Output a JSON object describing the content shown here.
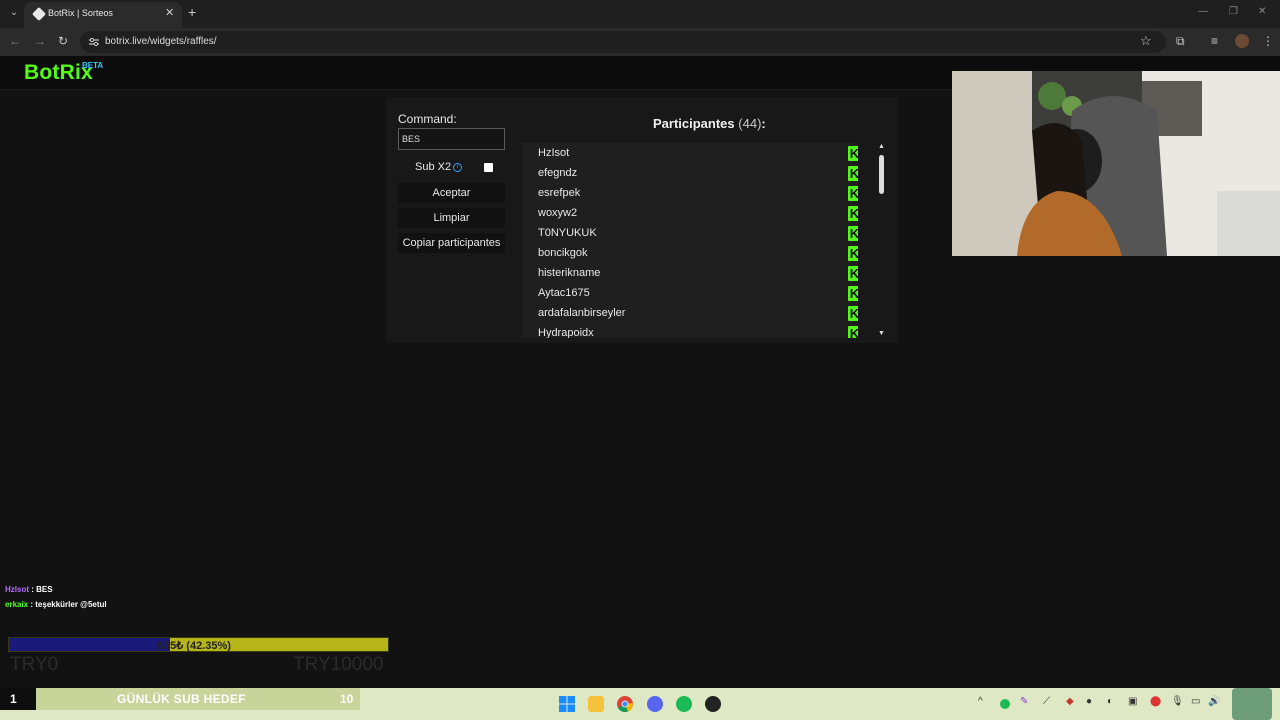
{
  "browser": {
    "tab_title": "BotRix | Sorteos",
    "url": "botrix.live/widgets/raffles/"
  },
  "app": {
    "logo": "BotRix",
    "logo_badge": "BETA"
  },
  "raffle": {
    "command_label": "Command:",
    "command_value": "BES",
    "sub_label": "Sub X2",
    "sub_checked": false,
    "accept_label": "Aceptar",
    "clear_label": "Limpiar",
    "copy_label": "Copiar participantes",
    "participants_title": "Participantes",
    "participants_count": "(44)",
    "participants_colon": ":",
    "participants": [
      {
        "name": "HzIsot",
        "badge": "K"
      },
      {
        "name": "efegndz",
        "badge": "K"
      },
      {
        "name": "esrefpek",
        "badge": "K"
      },
      {
        "name": "woxyw2",
        "badge": "K"
      },
      {
        "name": "T0NYUKUK",
        "badge": "K"
      },
      {
        "name": "boncikgok",
        "badge": "K"
      },
      {
        "name": "histerikname",
        "badge": "K"
      },
      {
        "name": "Aytac1675",
        "badge": "K"
      },
      {
        "name": "ardafalanbirseyler",
        "badge": "K"
      },
      {
        "name": "Hydrapoidx",
        "badge": "K"
      }
    ]
  },
  "chat": [
    {
      "user": "HzIsot",
      "sep": " : ",
      "message": "BES"
    },
    {
      "user": "erkaix",
      "sep": " : ",
      "message": "teşekkürler @5etul"
    }
  ],
  "donation_goal": {
    "progress_text": "₺35₺ (42.35%)",
    "progress_fraction": 0.4235,
    "min_label": "TRY0",
    "max_label": "TRY10000"
  },
  "sub_goal": {
    "current": "1",
    "label": "GÜNLÜK SUB HEDEF",
    "target": "10"
  },
  "colors": {
    "brand_green": "#53fc18",
    "beta_blue": "#39c6ff",
    "goal_fill": "#1a1a7a",
    "goal_bar": "#b5b51a"
  }
}
